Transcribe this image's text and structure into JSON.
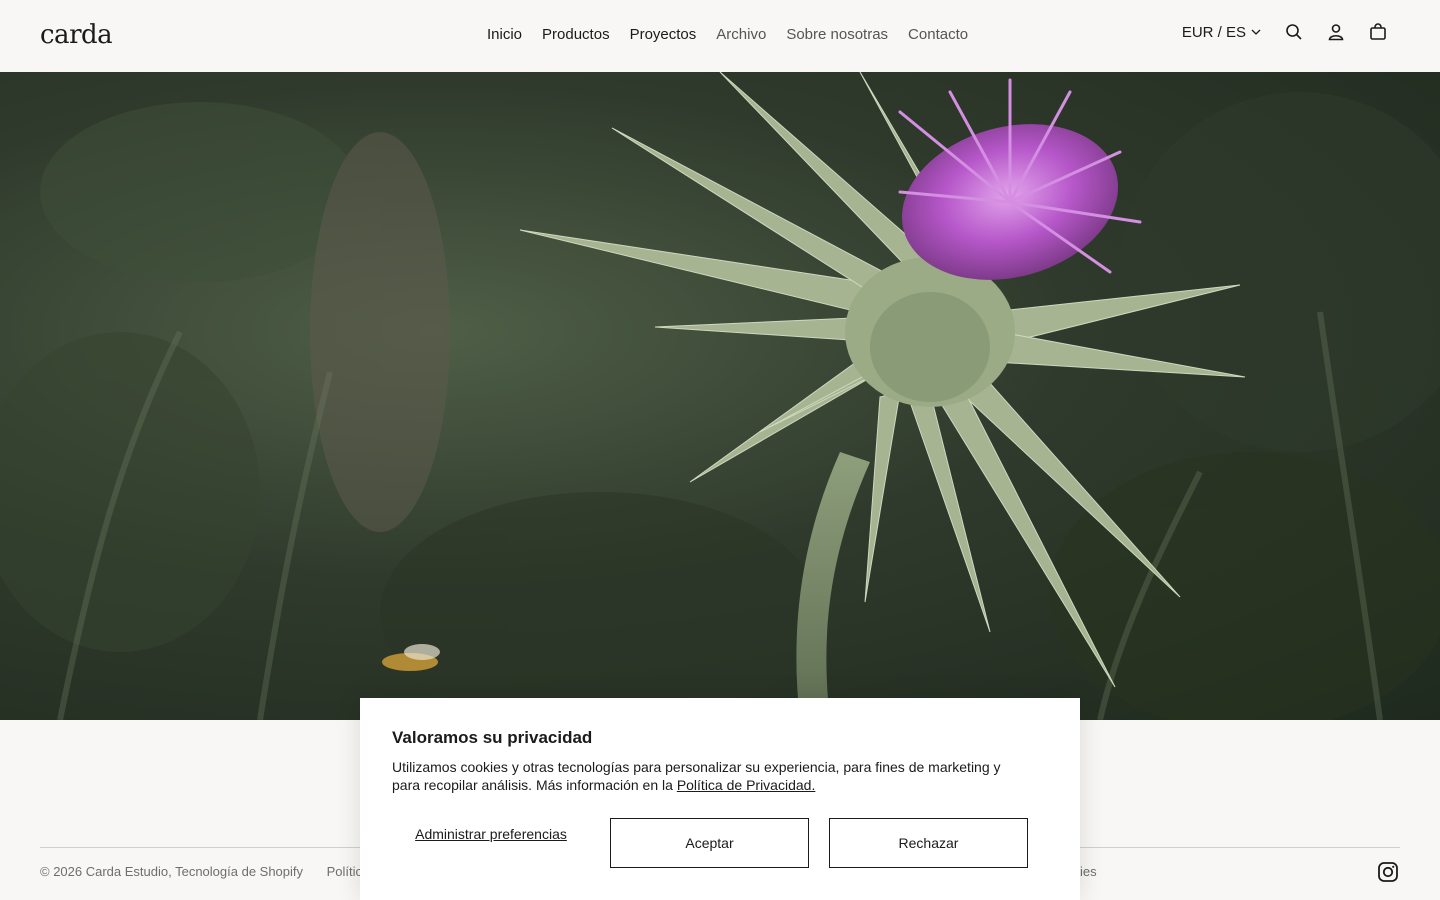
{
  "header": {
    "logo": "carda",
    "nav": [
      {
        "label": "Inicio"
      },
      {
        "label": "Productos"
      },
      {
        "label": "Proyectos"
      },
      {
        "label": "Archivo"
      },
      {
        "label": "Sobre nosotras"
      },
      {
        "label": "Contacto"
      }
    ],
    "locale": "EUR / ES",
    "icons": [
      "search-icon",
      "account-icon",
      "cart-icon"
    ]
  },
  "hero": {
    "image": "thistle-flower-video"
  },
  "cookie": {
    "title": "Valoramos su privacidad",
    "body": "Utilizamos cookies y otras tecnologías para personalizar su experiencia, para fines de marketing y para recopilar análisis. Más información en la ",
    "policy_link": "Política de Privacidad.",
    "manage": "Administrar preferencias",
    "accept": "Aceptar",
    "reject": "Rechazar"
  },
  "footer": {
    "copyright": "© 2026 Carda Estudio, Tecnología de Shopify",
    "policy_partial": "Política de r",
    "right_partial": "ies",
    "social_icon": "instagram-icon"
  },
  "colors": {
    "background": "#f8f7f5",
    "text": "#1b1b1b",
    "thistle": "#b657c9"
  }
}
